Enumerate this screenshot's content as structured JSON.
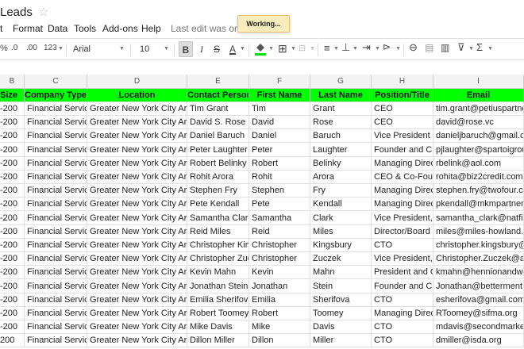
{
  "document": {
    "title": "Leads"
  },
  "menu": {
    "items": [
      "t",
      "Format",
      "Data",
      "Tools",
      "Add-ons",
      "Help"
    ],
    "last_edit": "Last edit was on Ju"
  },
  "status": {
    "working": "Working..."
  },
  "toolbar": {
    "percent": "%",
    "decrease_decimal": ".0",
    "increase_decimal": ".00",
    "number_format": "123",
    "font": "Arial",
    "font_size": "10",
    "bold": "B",
    "italic": "I",
    "strikethrough": "S",
    "text_color": "A"
  },
  "sheet": {
    "columns": [
      "B",
      "C",
      "D",
      "E",
      "F",
      "G",
      "H",
      "I"
    ],
    "header": [
      "Size",
      "Company Type",
      "Location",
      "Contact Person",
      "First Name",
      "Last Name",
      "Position/Title",
      "Email"
    ],
    "rows": [
      [
        "-200",
        "Financial Service",
        "Greater New York City Area",
        "Tim Grant",
        "Tim",
        "Grant",
        "CEO",
        "tim.grant@petiuspartners"
      ],
      [
        "-200",
        "Financial Service",
        "Greater New York City Area",
        "David S. Rose",
        "David",
        "Rose",
        "CEO",
        "david@rose.vc"
      ],
      [
        "-200",
        "Financial Service",
        "Greater New York City Area",
        "Daniel Baruch",
        "Daniel",
        "Baruch",
        "Vice President",
        "danieljbaruch@gmail.com"
      ],
      [
        "-200",
        "Financial Service",
        "Greater New York City Area",
        "Peter Laughter",
        "Peter",
        "Laughter",
        "Founder and CE",
        "pjlaughter@spartoigroup."
      ],
      [
        "-200",
        "Financial Service",
        "Greater New York City Area",
        "Robert Belinky",
        "Robert",
        "Belinky",
        "Managing Direct",
        "rbelink@aol.com"
      ],
      [
        "-200",
        "Financial Service",
        "Greater New York City Area",
        "Rohit Arora",
        "Rohit",
        "Arora",
        "CEO & Co-Foun",
        "rohita@biz2credit.com"
      ],
      [
        "-200",
        "Financial Service",
        "Greater New York City Area",
        "Stephen Fry",
        "Stephen",
        "Fry",
        "Managing Direct",
        "stephen.fry@twofour.com"
      ],
      [
        "-200",
        "Financial Service",
        "Greater New York City Area",
        "Pete Kendall",
        "Pete",
        "Kendall",
        "Managing Direct",
        "pkendall@mkmpartners.c"
      ],
      [
        "-200",
        "Financial Service",
        "Greater New York City Area",
        "Samantha Clark",
        "Samantha",
        "Clark",
        "Vice President, M",
        "samantha_clark@natfin.n"
      ],
      [
        "-200",
        "Financial Service",
        "Greater New York City Area",
        "Reid Miles",
        "Reid",
        "Miles",
        "Director/Board M",
        "miles@miles-howland.co"
      ],
      [
        "-200",
        "Financial Service",
        "Greater New York City Area",
        "Christopher King",
        "Christopher",
        "Kingsbury",
        "CTO",
        "christopher.kingsbury@tr"
      ],
      [
        "-200",
        "Financial Service",
        "Greater New York City Area",
        "Christopher Zucz",
        "Christopher",
        "Zuczek",
        "Vice President, F",
        "Christopher.Zuczek@albr"
      ],
      [
        "-200",
        "Financial Service",
        "Greater New York City Area",
        "Kevin Mahn",
        "Kevin",
        "Mahn",
        "President and Ch",
        "kmahn@hennionandwals"
      ],
      [
        "-200",
        "Financial Service",
        "Greater New York City Area",
        "Jonathan Stein",
        "Jonathan",
        "Stein",
        "Founder and CE",
        "Jonathan@betterment.co"
      ],
      [
        "-200",
        "Financial Service",
        "Greater New York City Area",
        "Emilia Sherifova",
        "Emilia",
        "Sherifova",
        "CTO",
        "esherifova@gmail.com"
      ],
      [
        "-200",
        "Financial Service",
        "Greater New York City Area",
        "Robert Toomey",
        "Robert",
        "Toomey",
        "Managing Direct",
        "RToomey@sifma.org"
      ],
      [
        "-200",
        "Financial Service",
        "Greater New York City Area",
        "Mike Davis",
        "Mike",
        "Davis",
        "CTO",
        "mdavis@secondmarket.c"
      ],
      [
        "200",
        "Financial Service",
        "Greater New York City Area",
        "Dillon Miller",
        "Dillon",
        "Miller",
        "CTO",
        "dmiller@isda.org"
      ]
    ]
  }
}
